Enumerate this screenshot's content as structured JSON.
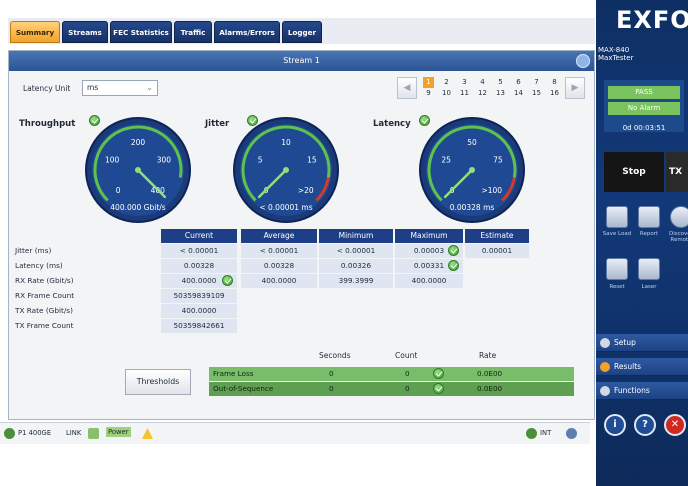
{
  "tabs": [
    {
      "label": "Summary",
      "active": true
    },
    {
      "label": "Streams",
      "active": false
    },
    {
      "label": "FEC Statistics",
      "active": false
    },
    {
      "label": "Traffic",
      "active": false
    },
    {
      "label": "Alarms/Errors",
      "active": false
    },
    {
      "label": "Logger",
      "active": false
    }
  ],
  "stream_title": "Stream 1",
  "latency_unit": {
    "label": "Latency Unit",
    "value": "ms"
  },
  "pager": {
    "active": "1",
    "row1": [
      "1",
      "2",
      "3",
      "4",
      "5",
      "6",
      "7",
      "8"
    ],
    "row2": [
      "9",
      "10",
      "11",
      "12",
      "13",
      "14",
      "15",
      "16"
    ],
    "prev": "◀",
    "next": "▶"
  },
  "gauges": [
    {
      "title": "Throughput",
      "ticks": [
        "0",
        "100",
        "200",
        "300",
        "400"
      ],
      "readout": "400.000 Gbit/s",
      "value_fraction": 1.0
    },
    {
      "title": "Jitter",
      "ticks": [
        "0",
        "5",
        "10",
        "15",
        ">20"
      ],
      "readout": "< 0.00001 ms",
      "value_fraction": 0.0
    },
    {
      "title": "Latency",
      "ticks": [
        "0",
        "25",
        "50",
        "75",
        ">100"
      ],
      "readout": "0.00328 ms",
      "value_fraction": 0.0
    }
  ],
  "table": {
    "headers": [
      "Current",
      "Average",
      "Minimum",
      "Maximum",
      "Estimate"
    ],
    "rows": [
      {
        "label": "Jitter (ms)",
        "cells": [
          "< 0.00001",
          "< 0.00001",
          "< 0.00001",
          "0.00003",
          "0.00001"
        ],
        "ok": [
          false,
          false,
          false,
          true,
          false
        ]
      },
      {
        "label": "Latency (ms)",
        "cells": [
          "0.00328",
          "0.00328",
          "0.00326",
          "0.00331",
          ""
        ],
        "ok": [
          false,
          false,
          false,
          true,
          false
        ]
      },
      {
        "label": "RX Rate (Gbit/s)",
        "cells": [
          "400.0000",
          "400.0000",
          "399.3999",
          "400.0000",
          ""
        ],
        "ok": [
          true,
          false,
          false,
          false,
          false
        ]
      },
      {
        "label": "RX Frame Count",
        "cells": [
          "50359839109",
          "",
          "",
          "",
          ""
        ],
        "ok": [
          false,
          false,
          false,
          false,
          false
        ]
      },
      {
        "label": "TX Rate (Gbit/s)",
        "cells": [
          "400.0000",
          "",
          "",
          "",
          ""
        ],
        "ok": [
          false,
          false,
          false,
          false,
          false
        ]
      },
      {
        "label": "TX Frame Count",
        "cells": [
          "50359842661",
          "",
          "",
          "",
          ""
        ],
        "ok": [
          false,
          false,
          false,
          false,
          false
        ]
      }
    ]
  },
  "loss": {
    "headers": [
      "Seconds",
      "Count",
      "Rate"
    ],
    "rows": [
      {
        "label": "Frame Loss",
        "seconds": "0",
        "count": "0",
        "rate": "0.0E00"
      },
      {
        "label": "Out-of-Sequence",
        "seconds": "0",
        "count": "0",
        "rate": "0.0E00"
      }
    ],
    "thresholds_label": "Thresholds"
  },
  "status": {
    "port": "P1 400GE",
    "link": "LINK",
    "power": "Power",
    "clock": "INT"
  },
  "sidebar": {
    "logo": "EXFO",
    "model_line1": "MAX-840",
    "model_line2": "MaxTester",
    "pass": "PASS",
    "alarm": "No Alarm",
    "timer": "0d 00:03:51",
    "stop": "Stop",
    "tx": "TX",
    "tools": [
      "Save Load",
      "Report",
      "Discover Remote",
      "Reset",
      "Laser"
    ],
    "menu": [
      "Setup",
      "Results",
      "Functions"
    ]
  },
  "colors": {
    "accent": "#f2a22b",
    "navy": "#1e3f86",
    "ok_green": "#3a9a2a"
  }
}
